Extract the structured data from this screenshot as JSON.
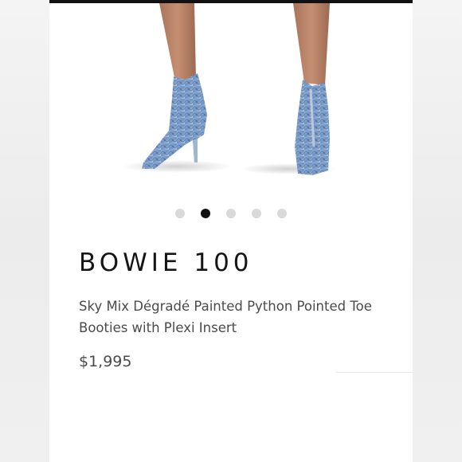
{
  "product": {
    "title": "BOWIE 100",
    "description": "Sky Mix Dégradé Painted Python Pointed Toe Booties with Plexi Insert",
    "price": "$1,995"
  },
  "carousel": {
    "total_slides": 5,
    "active_index": 1
  },
  "colors": {
    "accent": "#111111",
    "dot_inactive": "#d9d9d9",
    "text_primary": "#151515",
    "text_secondary": "#4a4a4a"
  }
}
